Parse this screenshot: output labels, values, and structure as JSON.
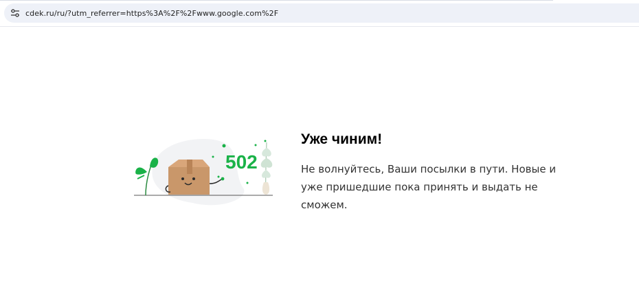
{
  "browser": {
    "url": "cdek.ru/ru/?utm_referrer=https%3A%2F%2Fwww.google.com%2F"
  },
  "error_page": {
    "code": "502",
    "title": "Уже чиним!",
    "message": "Не волнуйтесь, Ваши посылки в пути. Новые и уже пришедшие пока принять и выдать не сможем."
  },
  "colors": {
    "brand_green": "#1ab248",
    "box": "#c9976a"
  },
  "icons": [
    "site-info-icon"
  ]
}
